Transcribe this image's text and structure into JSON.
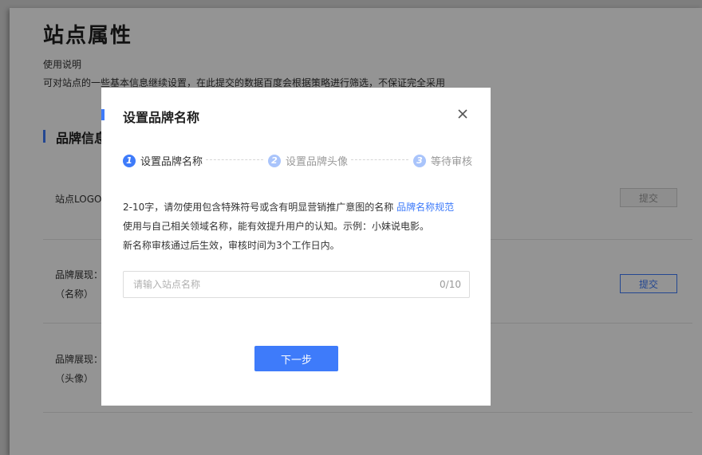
{
  "page": {
    "title": "站点属性",
    "intro_label": "使用说明",
    "intro_text": "可对站点的一些基本信息继续设置，在此提交的数据百度会根据策略进行筛选，不保证完全采用"
  },
  "section": {
    "title": "品牌信息"
  },
  "rows": {
    "logo_label": "站点LOGO",
    "name_label_line1": "品牌展现：",
    "name_label_line2": "（名称）",
    "avatar_label_line1": "品牌展现：",
    "avatar_label_line2": "（头像）",
    "submit_label": "提交"
  },
  "modal": {
    "title": "设置品牌名称",
    "steps": [
      {
        "num": "1",
        "label": "设置品牌名称",
        "state": "active"
      },
      {
        "num": "2",
        "label": "设置品牌头像",
        "state": "pending"
      },
      {
        "num": "3",
        "label": "等待审核",
        "state": "pending"
      }
    ],
    "desc_line1": "2-10字，请勿使用包含特殊符号或含有明显营销推广意图的名称",
    "desc_link": "品牌名称规范",
    "desc_line2": "使用与自己相关领域名称，能有效提升用户的认知。示例：小妹说电影。",
    "desc_line3": "新名称审核通过后生效，审核时间为3个工作日内。",
    "input_placeholder": "请输入站点名称",
    "input_value": "",
    "char_count": "0/10",
    "next_label": "下一步"
  },
  "colors": {
    "accent": "#3e7bfa",
    "accent_light": "#a9c4fb",
    "overlay": "rgba(0,0,0,0.42)"
  },
  "icons": {
    "close": "close-icon"
  }
}
